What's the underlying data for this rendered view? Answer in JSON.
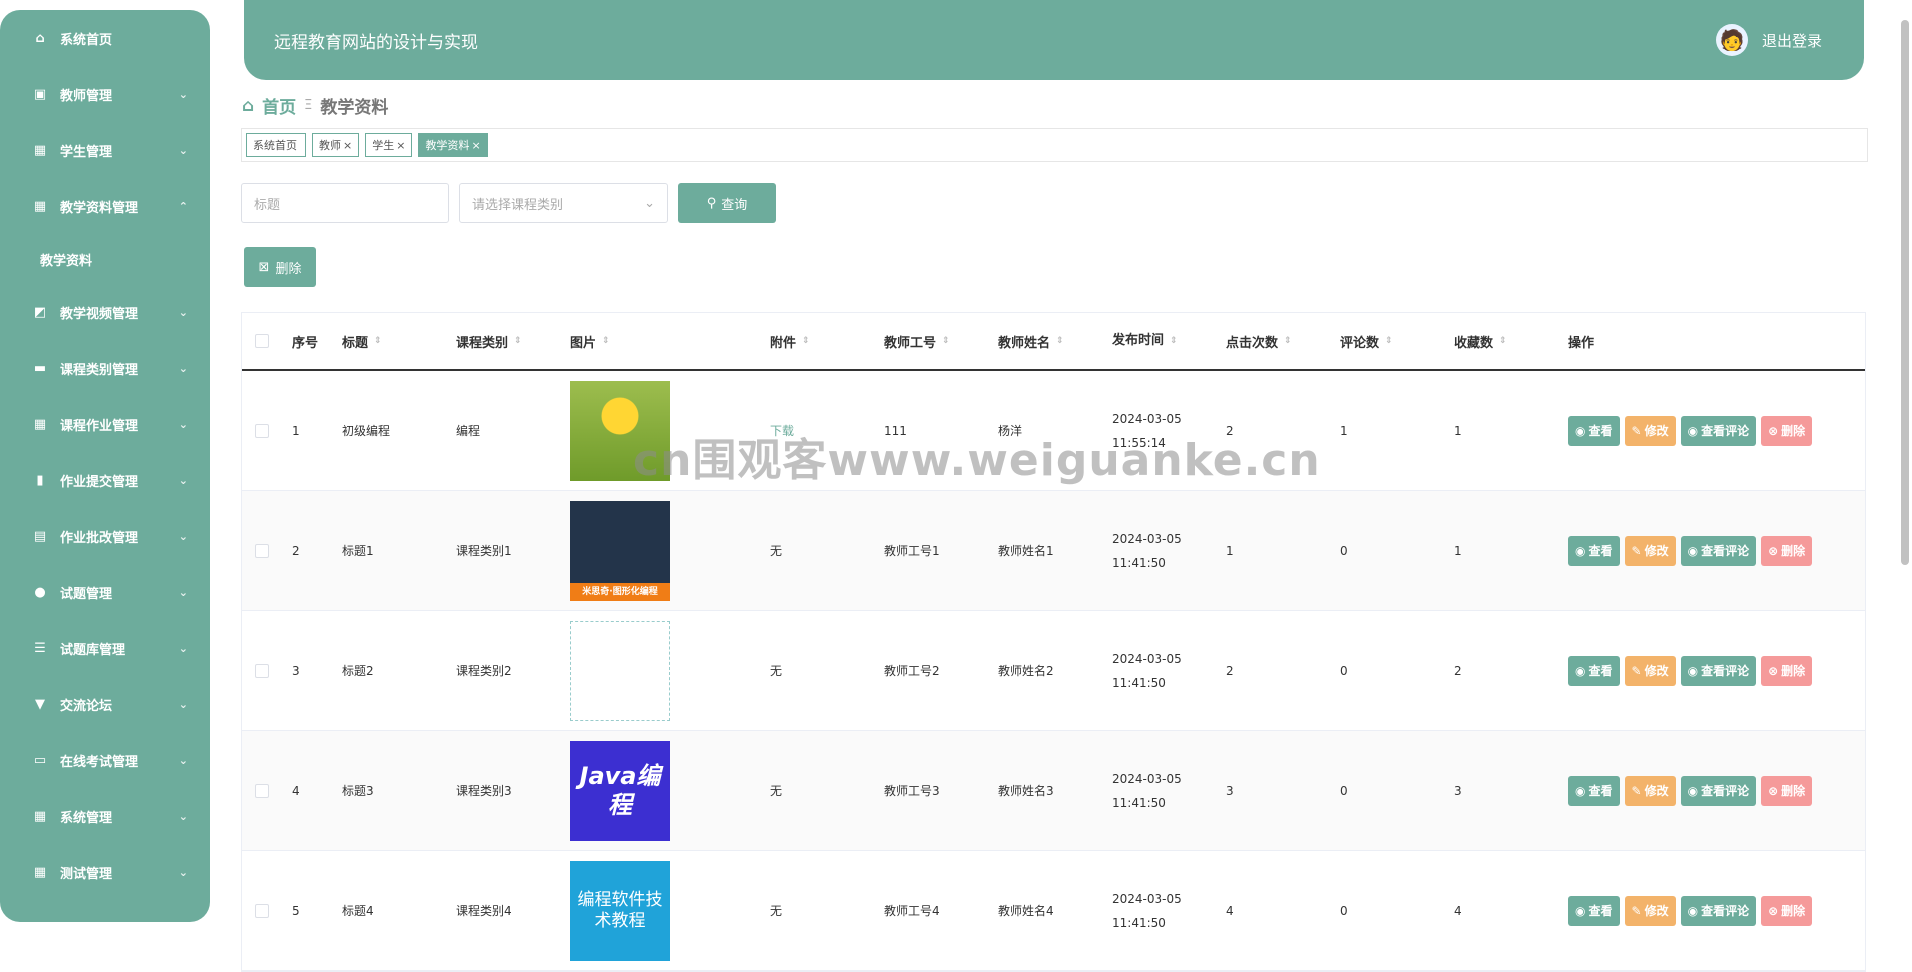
{
  "sidebar": {
    "items": [
      {
        "label": "系统首页",
        "icon": "home-icon",
        "glyph": "⌂",
        "chev": ""
      },
      {
        "label": "教师管理",
        "icon": "briefcase-icon",
        "glyph": "▣",
        "chev": "⌄"
      },
      {
        "label": "学生管理",
        "icon": "grid-icon",
        "glyph": "▦",
        "chev": "⌄"
      },
      {
        "label": "教学资料管理",
        "icon": "grid-icon",
        "glyph": "▦",
        "chev": "⌃",
        "sub": "教学资料"
      },
      {
        "label": "教学视频管理",
        "icon": "chart-icon",
        "glyph": "◩",
        "chev": "⌄"
      },
      {
        "label": "课程类别管理",
        "icon": "chat-icon",
        "glyph": "▬",
        "chev": "⌄"
      },
      {
        "label": "课程作业管理",
        "icon": "grid-icon",
        "glyph": "▦",
        "chev": "⌄"
      },
      {
        "label": "作业提交管理",
        "icon": "bar-chart-icon",
        "glyph": "▮",
        "chev": "⌄"
      },
      {
        "label": "作业批改管理",
        "icon": "clipboard-icon",
        "glyph": "▤",
        "chev": "⌄"
      },
      {
        "label": "试题管理",
        "icon": "user-icon",
        "glyph": "●",
        "chev": "⌄"
      },
      {
        "label": "试题库管理",
        "icon": "sliders-icon",
        "glyph": "☰",
        "chev": "⌄"
      },
      {
        "label": "交流论坛",
        "icon": "bookmark-icon",
        "glyph": "▼",
        "chev": "⌄"
      },
      {
        "label": "在线考试管理",
        "icon": "monitor-icon",
        "glyph": "▭",
        "chev": "⌄"
      },
      {
        "label": "系统管理",
        "icon": "grid-icon",
        "glyph": "▦",
        "chev": "⌄"
      },
      {
        "label": "测试管理",
        "icon": "grid-icon",
        "glyph": "▦",
        "chev": "⌄"
      }
    ]
  },
  "header": {
    "title": "远程教育网站的设计与实现",
    "logout": "退出登录"
  },
  "breadcrumb": {
    "home": "首页",
    "sep": "Ξ",
    "current": "教学资料"
  },
  "tags": [
    {
      "label": "系统首页",
      "close": ""
    },
    {
      "label": "教师",
      "close": "×"
    },
    {
      "label": "学生",
      "close": "×"
    },
    {
      "label": "教学资料",
      "close": "×"
    }
  ],
  "search": {
    "title_placeholder": "标题",
    "category_placeholder": "请选择课程类别",
    "query_label": "查询"
  },
  "actions": {
    "delete_label": "删除"
  },
  "table": {
    "headers": [
      "序号",
      "标题",
      "课程类别",
      "图片",
      "附件",
      "教师工号",
      "教师姓名",
      "发布时间",
      "点击次数",
      "评论数",
      "收藏数",
      "操作"
    ],
    "rows": [
      {
        "no": "1",
        "title": "初级编程",
        "category": "编程",
        "image": "",
        "attachment": "下载",
        "tno": "111",
        "tname": "杨洋",
        "time": "2024-03-05 11:55:14",
        "clicks": "2",
        "comments": "1",
        "fav": "1"
      },
      {
        "no": "2",
        "title": "标题1",
        "category": "课程类别1",
        "image": "米思奇·图形化编程",
        "attachment": "无",
        "tno": "教师工号1",
        "tname": "教师姓名1",
        "time": "2024-03-05 11:41:50",
        "clicks": "1",
        "comments": "0",
        "fav": "1"
      },
      {
        "no": "3",
        "title": "标题2",
        "category": "课程类别2",
        "image": "",
        "attachment": "无",
        "tno": "教师工号2",
        "tname": "教师姓名2",
        "time": "2024-03-05 11:41:50",
        "clicks": "2",
        "comments": "0",
        "fav": "2"
      },
      {
        "no": "4",
        "title": "标题3",
        "category": "课程类别3",
        "image": "Java编程",
        "attachment": "无",
        "tno": "教师工号3",
        "tname": "教师姓名3",
        "time": "2024-03-05 11:41:50",
        "clicks": "3",
        "comments": "0",
        "fav": "3"
      },
      {
        "no": "5",
        "title": "标题4",
        "category": "课程类别4",
        "image": "编程软件技术教程",
        "attachment": "无",
        "tno": "教师工号4",
        "tname": "教师姓名4",
        "time": "2024-03-05 11:41:50",
        "clicks": "4",
        "comments": "0",
        "fav": "4"
      }
    ],
    "ops": {
      "view": "查看",
      "edit": "修改",
      "comments": "查看评论",
      "delete": "删除"
    }
  },
  "watermark": "cn围观客www.weiguanke.cn",
  "colors": {
    "primary": "#6dac9c",
    "edit": "#f3b36a",
    "delete": "#f59a9a"
  }
}
